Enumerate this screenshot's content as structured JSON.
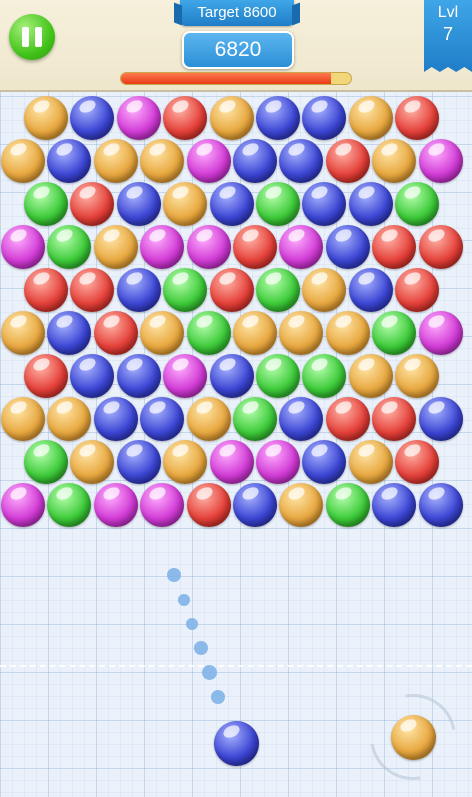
{
  "hud": {
    "target_label": "Target 8600",
    "score": "6820",
    "level_label": "Lvl",
    "level_value": "7",
    "progress_fraction": 0.915
  },
  "colors": {
    "orange": "#e8a840",
    "blue": "#3c46d4",
    "magenta": "#d23cd6",
    "red": "#e5413a",
    "green": "#3ecb3a"
  },
  "board": {
    "rows": [
      [
        "orange",
        "blue",
        "magenta",
        "red",
        "orange",
        "blue",
        "blue",
        "orange",
        "red"
      ],
      [
        "orange",
        "blue",
        "orange",
        "orange",
        "magenta",
        "blue",
        "blue",
        "red",
        "orange",
        "magenta"
      ],
      [
        "green",
        "red",
        "blue",
        "orange",
        "blue",
        "green",
        "blue",
        "blue",
        "green"
      ],
      [
        "magenta",
        "green",
        "orange",
        "magenta",
        "magenta",
        "red",
        "magenta",
        "blue",
        "red",
        "red"
      ],
      [
        "red",
        "red",
        "blue",
        "green",
        "red",
        "green",
        "orange",
        "blue",
        "red"
      ],
      [
        "orange",
        "blue",
        "red",
        "orange",
        "green",
        "orange",
        "orange",
        "orange",
        "green",
        "magenta"
      ],
      [
        "red",
        "blue",
        "blue",
        "magenta",
        "blue",
        "green",
        "green",
        "orange",
        "orange"
      ],
      [
        "orange",
        "orange",
        "blue",
        "blue",
        "orange",
        "green",
        "blue",
        "red",
        "red",
        "blue"
      ],
      [
        "green",
        "orange",
        "blue",
        "orange",
        "magenta",
        "magenta",
        "blue",
        "orange",
        "red"
      ],
      [
        "magenta",
        "green",
        "magenta",
        "magenta",
        "red",
        "blue",
        "orange",
        "green",
        "blue",
        "blue"
      ]
    ]
  },
  "shooter": {
    "current": "blue",
    "next": "orange"
  }
}
